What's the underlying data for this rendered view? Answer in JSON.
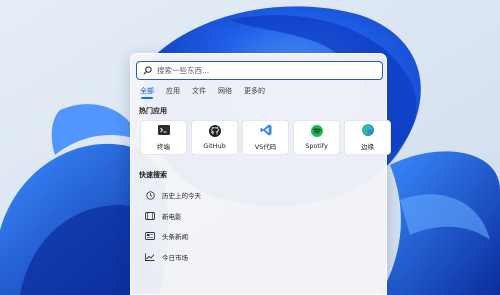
{
  "search": {
    "placeholder": "搜索一些东西..."
  },
  "tabs": [
    {
      "label": "全部",
      "active": true
    },
    {
      "label": "应用",
      "active": false
    },
    {
      "label": "文件",
      "active": false
    },
    {
      "label": "网络",
      "active": false
    },
    {
      "label": "更多的",
      "active": false
    }
  ],
  "popular_apps": {
    "title": "热门应用",
    "items": [
      {
        "label": "终端",
        "icon": "terminal-icon"
      },
      {
        "label": "GitHub",
        "icon": "github-icon"
      },
      {
        "label": "VS代码",
        "icon": "vscode-icon"
      },
      {
        "label": "Spotify",
        "icon": "spotify-icon"
      },
      {
        "label": "边缘",
        "icon": "edge-icon"
      }
    ]
  },
  "quick_search": {
    "title": "快速搜索",
    "items": [
      {
        "label": "历史上的今天",
        "icon": "clock-icon"
      },
      {
        "label": "新电影",
        "icon": "film-icon"
      },
      {
        "label": "头条新闻",
        "icon": "news-icon"
      },
      {
        "label": "今日市场",
        "icon": "chart-icon"
      }
    ]
  },
  "colors": {
    "accent": "#1f5fae",
    "wallpaper_bg": "#dfe8f3",
    "bloom_blue": "#1f5ee8",
    "vscode_blue": "#2e8be8",
    "spotify_green": "#1db954"
  }
}
